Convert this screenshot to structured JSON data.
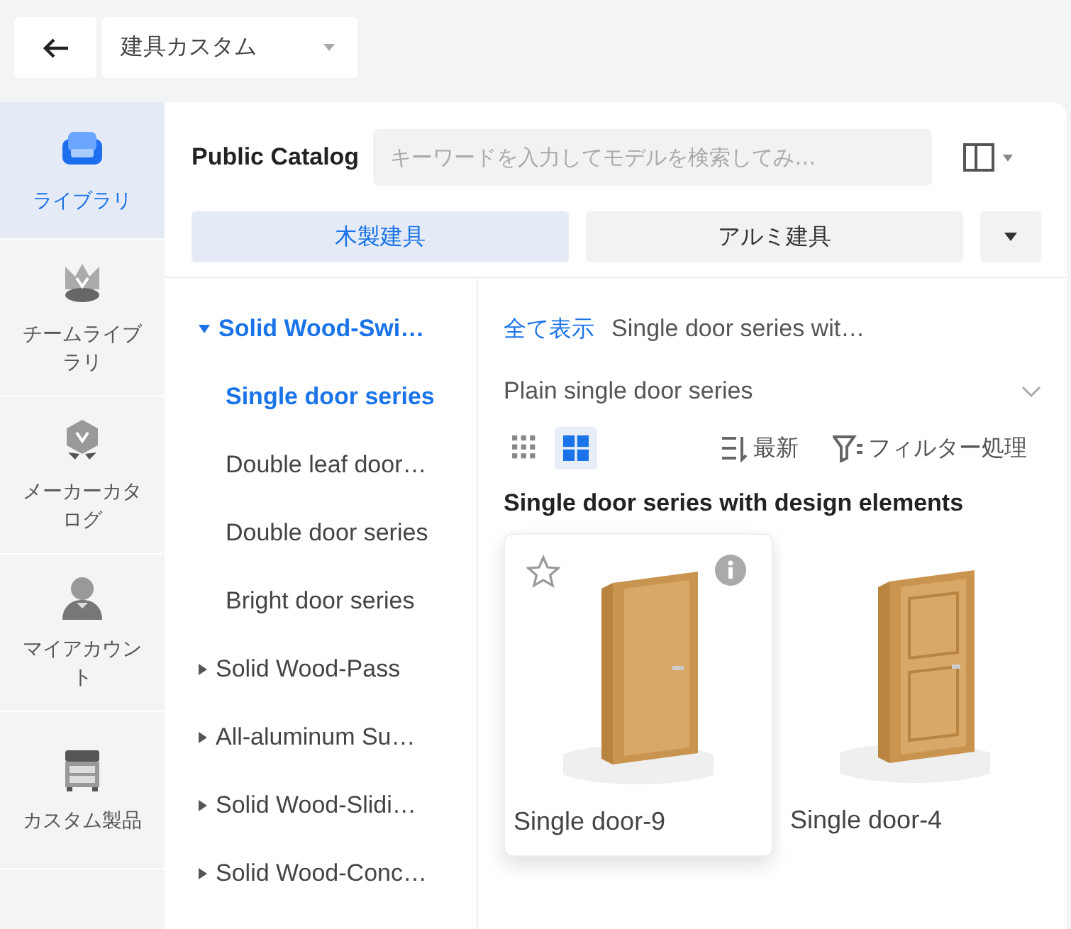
{
  "top_bar": {
    "title_dropdown": "建具カスタム"
  },
  "sidebar": {
    "items": [
      {
        "label": "ライブラリ",
        "kind": "library",
        "selected": true
      },
      {
        "label": "チームライブラリ",
        "kind": "team",
        "selected": false
      },
      {
        "label": "メーカーカタログ",
        "kind": "maker",
        "selected": false
      },
      {
        "label": "マイアカウント",
        "kind": "account",
        "selected": false
      },
      {
        "label": "カスタム製品",
        "kind": "custom",
        "selected": false
      }
    ]
  },
  "panel": {
    "title": "Public Catalog",
    "search": {
      "placeholder": "キーワードを入力してモデルを検索してみ…"
    },
    "tabs": [
      {
        "label": "木製建具",
        "selected": true
      },
      {
        "label": "アルミ建具",
        "selected": false
      }
    ]
  },
  "tree": [
    {
      "label": "Solid Wood-Swi…",
      "expanded": true,
      "children": [
        {
          "label": "Single door series",
          "selected": true
        },
        {
          "label": "Double leaf door…",
          "selected": false
        },
        {
          "label": "Double door series",
          "selected": false
        },
        {
          "label": "Bright door series",
          "selected": false
        }
      ]
    },
    {
      "label": "Solid Wood-Pass",
      "expanded": false
    },
    {
      "label": "All-aluminum Su…",
      "expanded": false
    },
    {
      "label": "Solid Wood-Slidi…",
      "expanded": false
    },
    {
      "label": "Solid Wood-Conc…",
      "expanded": false
    }
  ],
  "content": {
    "breadcrumb": {
      "link": "全て表示",
      "current": "Single door series wit…"
    },
    "subcategory": "Plain single door series",
    "view_modes": [
      {
        "kind": "small",
        "selected": false
      },
      {
        "kind": "large",
        "selected": true
      }
    ],
    "sort": "最新",
    "filter": "フィルター処理",
    "section_title": "Single door series with design elements",
    "products": [
      {
        "name": "Single door-9",
        "hovered": true,
        "kind": "flush"
      },
      {
        "name": "Single door-4",
        "hovered": false,
        "kind": "panel"
      }
    ]
  }
}
